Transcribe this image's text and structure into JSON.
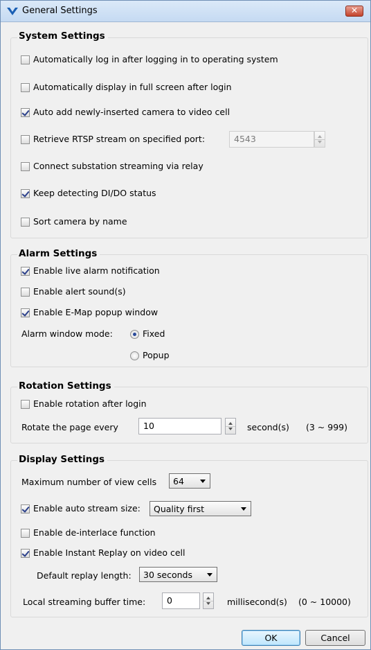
{
  "window": {
    "title": "General Settings"
  },
  "system": {
    "title": "System Settings",
    "auto_login": {
      "label": "Automatically log in after logging in to operating system",
      "checked": false
    },
    "fullscreen": {
      "label": "Automatically display in full screen after login",
      "checked": false
    },
    "auto_add_camera": {
      "label": "Auto add newly-inserted camera to video cell",
      "checked": true
    },
    "rtsp": {
      "label": "Retrieve RTSP stream on specified port:",
      "checked": false,
      "port": "4543"
    },
    "relay": {
      "label": "Connect substation streaming via relay",
      "checked": false
    },
    "dido": {
      "label": "Keep detecting DI/DO status",
      "checked": true
    },
    "sort": {
      "label": "Sort camera by name",
      "checked": false
    }
  },
  "alarm": {
    "title": "Alarm Settings",
    "live_notify": {
      "label": "Enable live alarm notification",
      "checked": true
    },
    "alert_sound": {
      "label": "Enable alert sound(s)",
      "checked": false
    },
    "emap_popup": {
      "label": "Enable E-Map popup window",
      "checked": true
    },
    "window_mode_label": "Alarm window mode:",
    "mode_fixed": "Fixed",
    "mode_popup": "Popup",
    "selected_mode": "Fixed"
  },
  "rotation": {
    "title": "Rotation Settings",
    "enable": {
      "label": "Enable rotation after login",
      "checked": false
    },
    "rotate_label": "Rotate the page every",
    "rotate_value": "10",
    "unit": "second(s)",
    "range": "(3 ~ 999)"
  },
  "display": {
    "title": "Display Settings",
    "max_cells_label": "Maximum number of view cells",
    "max_cells_value": "64",
    "auto_stream": {
      "label": "Enable auto stream size:",
      "checked": true,
      "value": "Quality first"
    },
    "deinterlace": {
      "label": "Enable de-interlace function",
      "checked": false
    },
    "instant_replay": {
      "label": "Enable Instant Replay on video cell",
      "checked": true
    },
    "replay_length_label": "Default replay length:",
    "replay_length_value": "30 seconds",
    "buffer_label": "Local streaming buffer time:",
    "buffer_value": "0",
    "buffer_unit": "millisecond(s)",
    "buffer_range": "(0 ~ 10000)"
  },
  "buttons": {
    "ok": "OK",
    "cancel": "Cancel"
  }
}
